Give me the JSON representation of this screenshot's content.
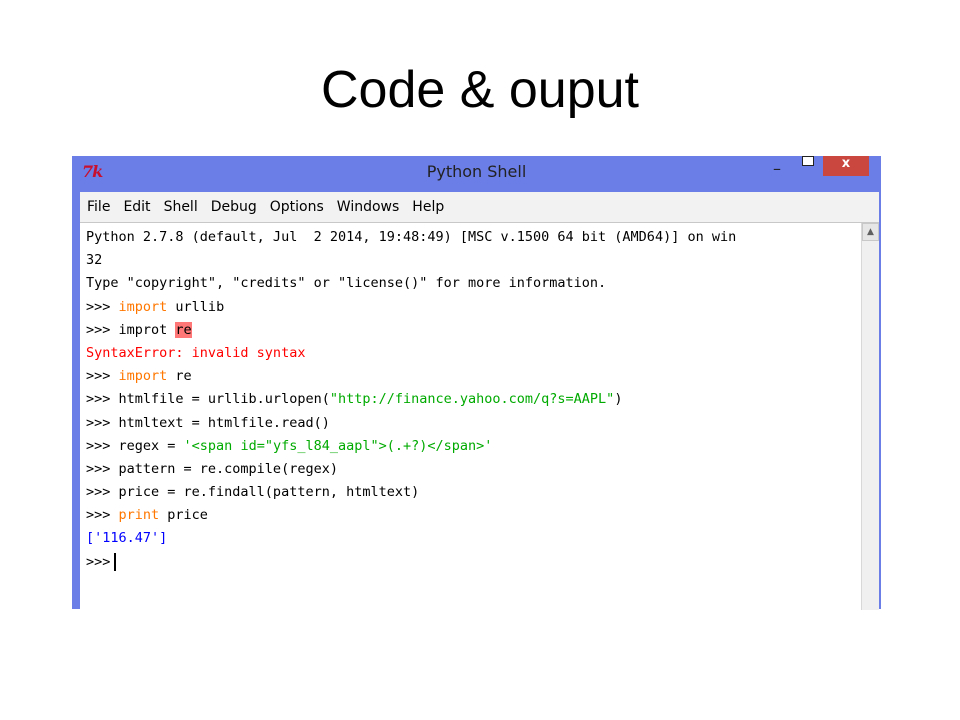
{
  "slide": {
    "title": "Code & ouput"
  },
  "window": {
    "title": "Python Shell",
    "icon_text": "7k",
    "minimize": "–",
    "close": "x"
  },
  "menu": [
    "File",
    "Edit",
    "Shell",
    "Debug",
    "Options",
    "Windows",
    "Help"
  ],
  "shell": {
    "lines": [
      [
        {
          "t": "Python 2.7.8 (default, Jul  2 2014, 19:48:49) [MSC v.1500 64 bit (AMD64)] on win",
          "c": ""
        }
      ],
      [
        {
          "t": "32",
          "c": ""
        }
      ],
      [
        {
          "t": "Type \"copyright\", \"credits\" or \"license()\" for more information.",
          "c": ""
        }
      ],
      [
        {
          "t": ">>> ",
          "c": ""
        },
        {
          "t": "import",
          "c": "kw"
        },
        {
          "t": " urllib",
          "c": ""
        }
      ],
      [
        {
          "t": ">>> improt ",
          "c": ""
        },
        {
          "t": "re",
          "c": "err-hl"
        }
      ],
      [
        {
          "t": "SyntaxError: invalid syntax",
          "c": "err"
        }
      ],
      [
        {
          "t": ">>> ",
          "c": ""
        },
        {
          "t": "import",
          "c": "kw"
        },
        {
          "t": " re",
          "c": ""
        }
      ],
      [
        {
          "t": ">>> htmlfile = urllib.urlopen(",
          "c": ""
        },
        {
          "t": "\"http://finance.yahoo.com/q?s=AAPL\"",
          "c": "str"
        },
        {
          "t": ")",
          "c": ""
        }
      ],
      [
        {
          "t": ">>> htmltext = htmlfile.read()",
          "c": ""
        }
      ],
      [
        {
          "t": ">>> regex = ",
          "c": ""
        },
        {
          "t": "'<span id=\"yfs_l84_aapl\">(.+?)</span>'",
          "c": "str"
        }
      ],
      [
        {
          "t": ">>> pattern = re.compile(regex)",
          "c": ""
        }
      ],
      [
        {
          "t": ">>> price = re.findall(pattern, htmltext)",
          "c": ""
        }
      ],
      [
        {
          "t": ">>> ",
          "c": ""
        },
        {
          "t": "print",
          "c": "kw"
        },
        {
          "t": " price",
          "c": ""
        }
      ],
      [
        {
          "t": "['116.47']",
          "c": "out"
        }
      ],
      [
        {
          "t": ">>>",
          "c": ""
        }
      ]
    ]
  }
}
